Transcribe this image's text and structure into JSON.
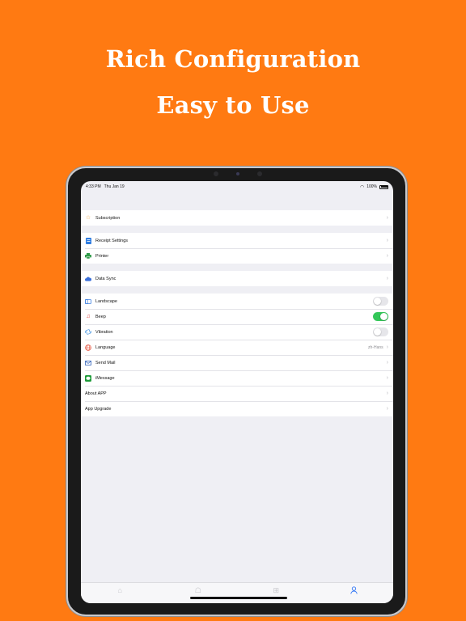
{
  "headline": {
    "line1": "Rich Configuration",
    "line2": "Easy to Use"
  },
  "statusbar": {
    "time": "4:33 PM",
    "date": "Thu Jan 19",
    "battery": "100%"
  },
  "settings": {
    "subscription": "Subscription",
    "receipt_settings": "Receipt Settings",
    "printer": "Printer",
    "data_sync": "Data Sync",
    "landscape": "Landscape",
    "beep": "Beep",
    "vibration": "Vibration",
    "language": "Language",
    "language_value": "zh-Hans",
    "send_mail": "Send Mail",
    "imessage": "iMessage",
    "about_app": "About APP",
    "app_upgrade": "App Upgrade"
  },
  "toggles": {
    "landscape": false,
    "beep": true,
    "vibration": false
  },
  "colors": {
    "background": "#FF7A12",
    "toggle_on": "#34c759",
    "tab_active": "#3478f6"
  },
  "icons": {
    "subscription": "star-icon",
    "receipt_settings": "document-icon",
    "printer": "printer-icon",
    "data_sync": "cloud-icon",
    "landscape": "rotate-icon",
    "beep": "music-note-icon",
    "vibration": "vibration-icon",
    "language": "globe-icon",
    "send_mail": "mail-icon",
    "imessage": "message-icon",
    "tab_home": "home-icon",
    "tab_chat": "chat-icon",
    "tab_add": "add-icon",
    "tab_profile": "person-icon"
  }
}
